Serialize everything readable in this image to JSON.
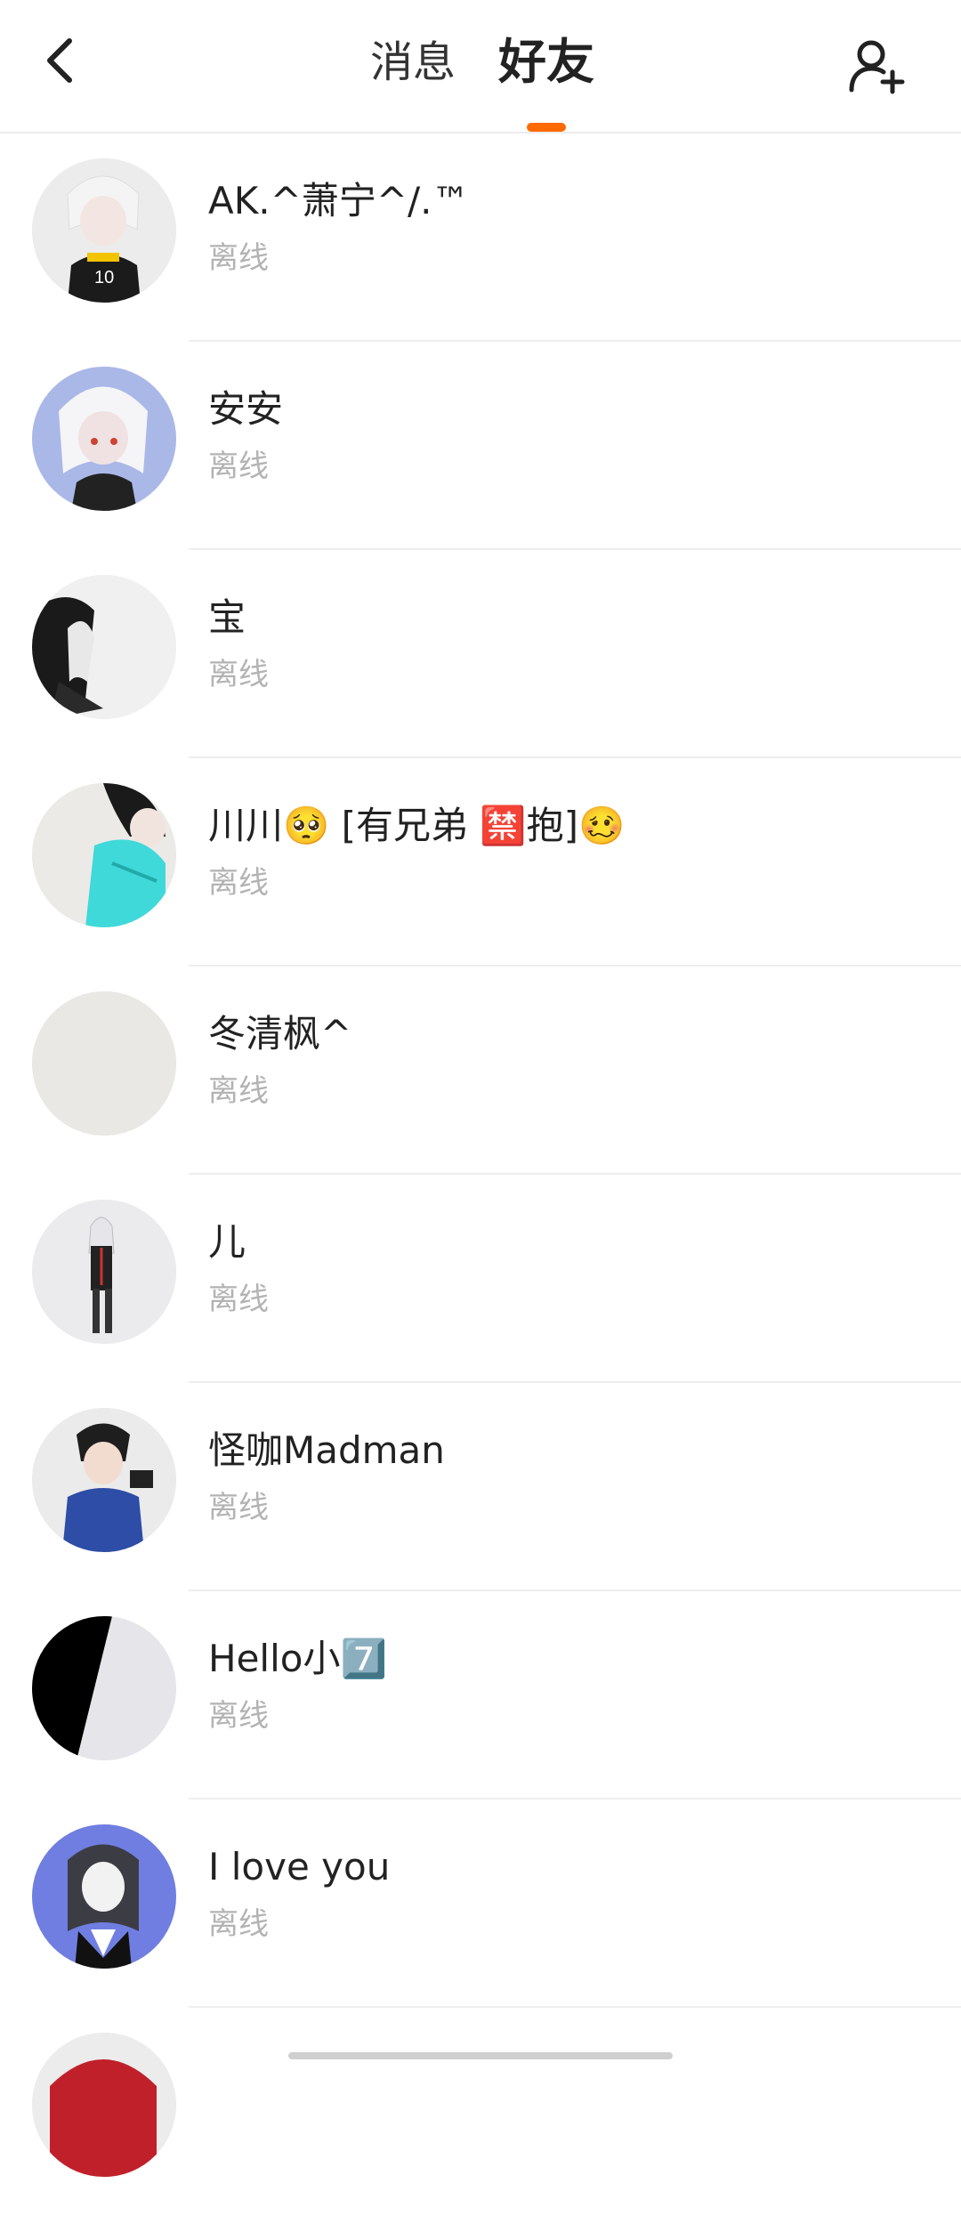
{
  "header": {
    "tabs": [
      {
        "label": "消息",
        "active": false
      },
      {
        "label": "好友",
        "active": true
      }
    ],
    "accent_color": "#ff6a00",
    "icons": {
      "back": "chevron-left-icon",
      "add_friend": "add-user-icon"
    }
  },
  "friends": [
    {
      "name": "AK.^萧宁^/.™",
      "status": "离线"
    },
    {
      "name": "安安",
      "status": "离线"
    },
    {
      "name": "宝",
      "status": "离线"
    },
    {
      "name": "川川🥺 [有兄弟 🈲抱]🥴",
      "status": "离线"
    },
    {
      "name": "冬清枫^",
      "status": "离线"
    },
    {
      "name": "儿",
      "status": "离线"
    },
    {
      "name": "怪咖Madman",
      "status": "离线"
    },
    {
      "name": "Hello小7️⃣",
      "status": "离线"
    },
    {
      "name": "I love you",
      "status": "离线"
    }
  ]
}
